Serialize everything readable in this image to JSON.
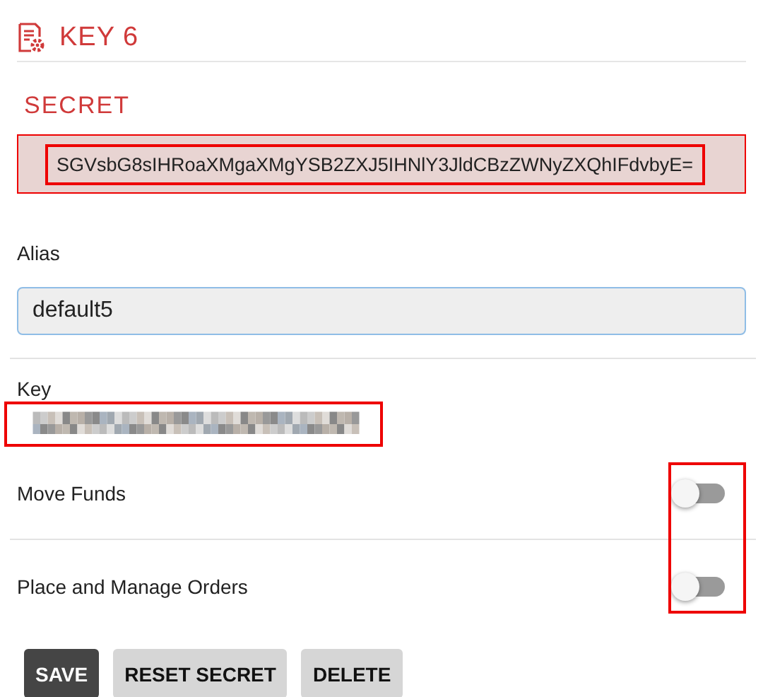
{
  "header": {
    "title": "KEY 6"
  },
  "secret": {
    "label": "SECRET",
    "value": "SGVsbG8sIHRoaXMgaXMgYSB2ZXJ5IHNlY3JldCBzZWNyZXQhIFdvbyE="
  },
  "alias": {
    "label": "Alias",
    "value": "default5"
  },
  "key": {
    "label": "Key"
  },
  "permissions": [
    {
      "label": "Move Funds",
      "on": false
    },
    {
      "label": "Place and Manage Orders",
      "on": false
    }
  ],
  "buttons": [
    {
      "label": "SAVE",
      "kind": "primary"
    },
    {
      "label": "RESET SECRET",
      "kind": "secondary"
    },
    {
      "label": "DELETE",
      "kind": "secondary"
    }
  ]
}
